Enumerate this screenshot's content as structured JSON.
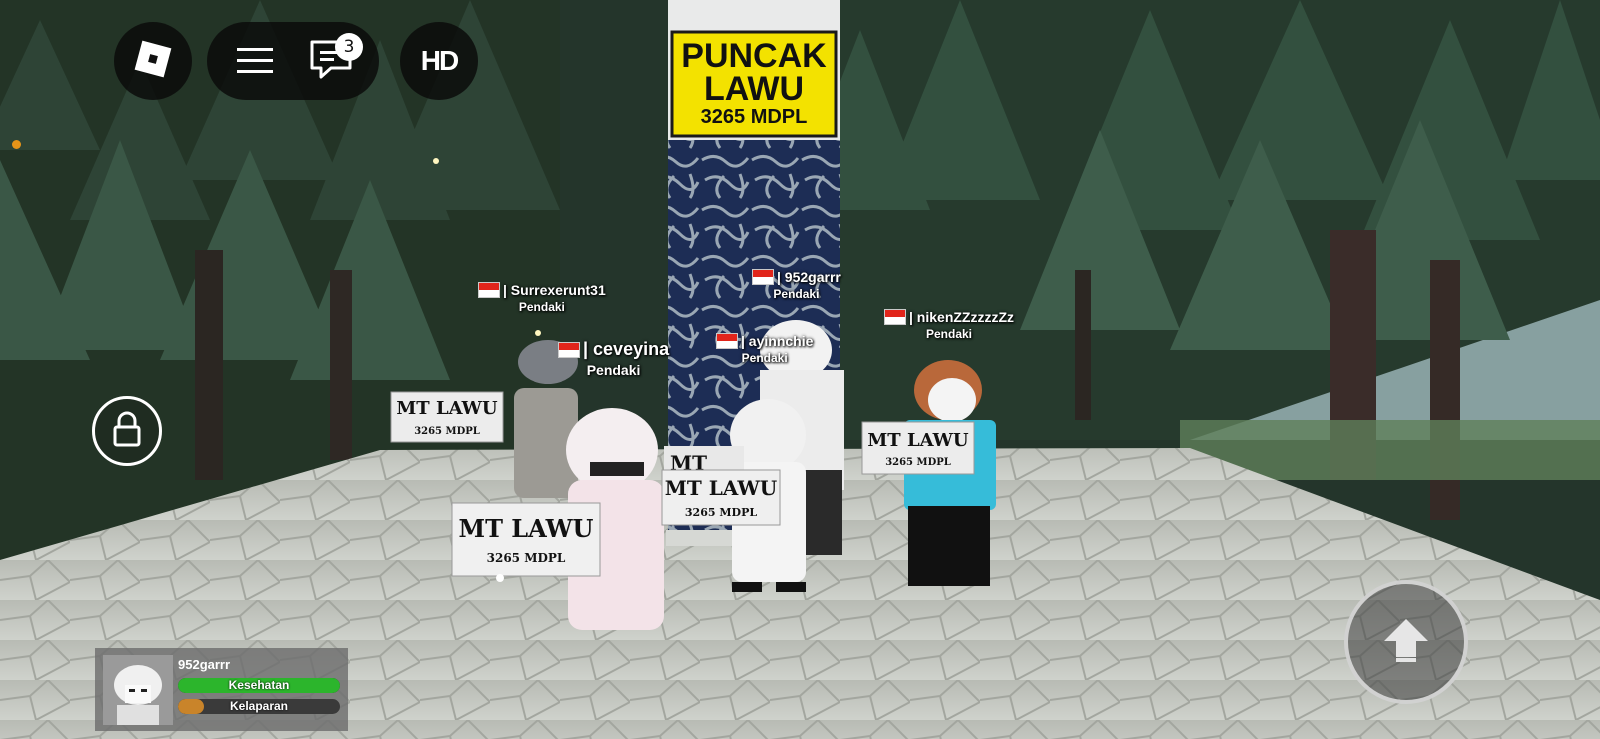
{
  "monument": {
    "line1": "PUNCAK",
    "line2": "LAWU",
    "line3": "3265 MDPL"
  },
  "sign_text": {
    "title": "MT LAWU",
    "sub": "3265 MDPL"
  },
  "chat": {
    "unread_count": "3"
  },
  "hd_label": "HD",
  "players": [
    {
      "name": "| Surrexerunt31",
      "role": "Pendaki"
    },
    {
      "name": "| 952garrr",
      "role": "Pendaki"
    },
    {
      "name": "| ceveyina",
      "role": "Pendaki"
    },
    {
      "name": "| ayinnchie",
      "role": "Pendaki"
    },
    {
      "name": "| nikenZZzzzzZz",
      "role": "Pendaki"
    }
  ],
  "status": {
    "player_name": "952garrr",
    "health_label": "Kesehatan",
    "health_value": 1.0,
    "health_color": "#2cb52c",
    "hunger_label": "Kelaparan",
    "hunger_value": 0.16,
    "hunger_color": "#c9842a"
  },
  "icons": {
    "roblox": "roblox-logo-icon",
    "menu": "hamburger-menu-icon",
    "chat": "chat-bubble-icon",
    "lock": "shift-lock-icon",
    "jump": "jump-arrow-icon"
  }
}
